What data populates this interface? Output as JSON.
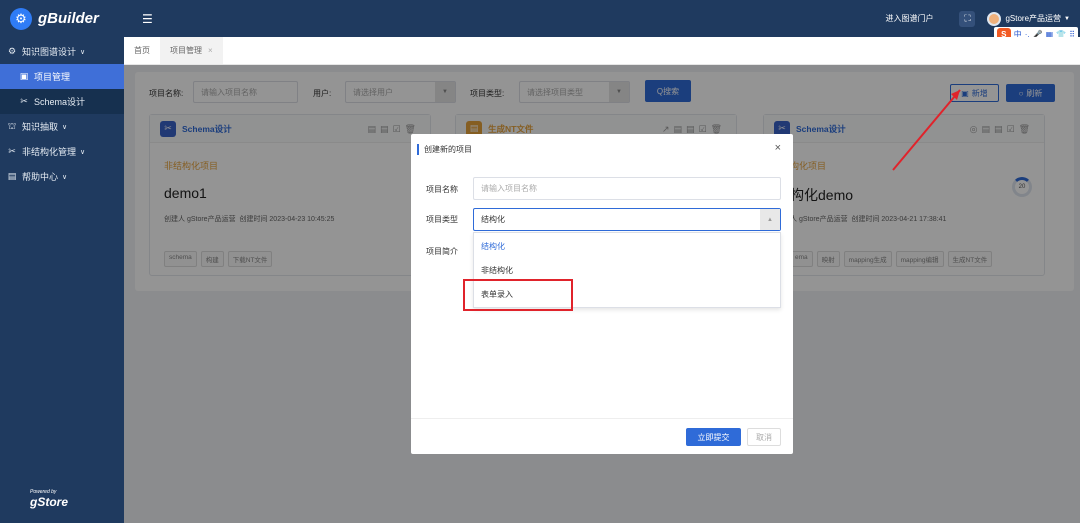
{
  "app": {
    "logo_text": "gBuilder",
    "logo_icon": "gear-g-icon",
    "powered_by": "Powered by",
    "powered_brand": "gStore"
  },
  "sidebar": {
    "items": [
      {
        "label": "知识图谱设计",
        "icon": "gear-icon"
      },
      {
        "label": "项目管理",
        "icon": "project-icon"
      },
      {
        "label": "Schema设计",
        "icon": "schema-icon"
      },
      {
        "label": "知识抽取",
        "icon": "extract-icon"
      },
      {
        "label": "非结构化管理",
        "icon": "unstructured-icon"
      },
      {
        "label": "帮助中心",
        "icon": "help-icon"
      }
    ]
  },
  "topbar": {
    "menu_icon": "hamburger-icon",
    "portal_link": "进入图谱门户",
    "user_name": "gStore产品运营",
    "fullscreen_icon": "fullscreen-icon"
  },
  "ime_toolbar": {
    "logo": "S",
    "items": [
      "中",
      "·,",
      "🎤",
      "▦",
      "👕",
      "⠿"
    ]
  },
  "tabs": [
    {
      "label": "首页"
    },
    {
      "label": "项目管理",
      "close": "×"
    }
  ],
  "filters": {
    "name_label": "项目名称:",
    "name_placeholder": "请输入项目名称",
    "user_label": "用户:",
    "user_placeholder": "请选择用户",
    "type_label": "项目类型:",
    "type_placeholder": "请选择项目类型",
    "search_label": "Q搜索",
    "add_label": "新增",
    "refresh_label": "刷新"
  },
  "cards": [
    {
      "header": "Schema设计",
      "type": "非结构化项目",
      "name": "demo1",
      "creator": "创建人 gStore产品运营",
      "created": "创建时间 2023-04-23 10:45:25",
      "tags": [
        "schema",
        "构建",
        "下载NT文件"
      ]
    },
    {
      "header": "生成NT文件"
    },
    {
      "header": "Schema设计",
      "type": "构化项目",
      "name": "构化demo",
      "creator": "人 gStore产品运营",
      "created": "创建时间 2023-04-21 17:38:41",
      "tags": [
        "ema",
        "映射",
        "mapping生成",
        "mapping编辑",
        "生成NT文件"
      ],
      "progress": "20"
    }
  ],
  "modal": {
    "title": "创建新的项目",
    "name_label": "项目名称",
    "name_placeholder": "请输入项目名称",
    "type_label": "项目类型",
    "type_value": "结构化",
    "desc_label": "项目简介",
    "options": [
      "结构化",
      "非结构化",
      "表单录入"
    ],
    "submit": "立即提交",
    "cancel": "取消",
    "close": "×"
  },
  "colors": {
    "accent": "#2f6bd8",
    "sidebar": "#1f3a5f",
    "highlight": "#e0232b"
  }
}
